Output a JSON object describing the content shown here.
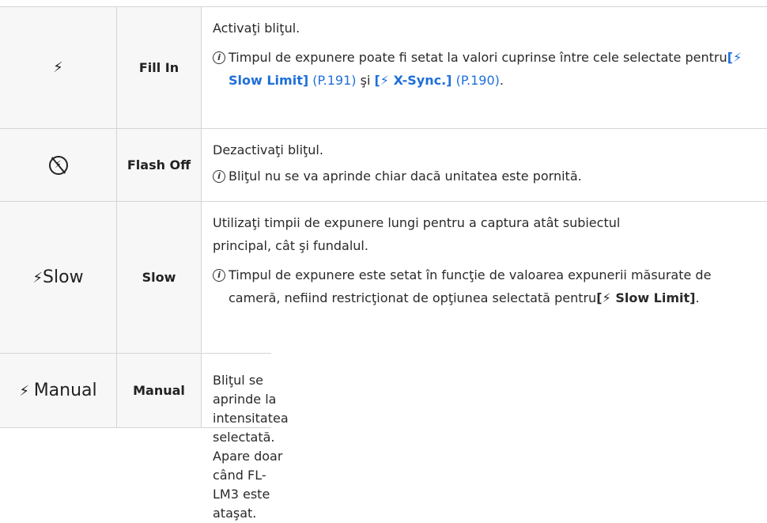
{
  "rows": [
    {
      "icon_label": "⚡",
      "icon_name": "flash-icon",
      "name": "Fill In",
      "desc_lines": [
        "Activaţi bliţul."
      ],
      "note": {
        "text_before": "Timpul de expunere poate fi setat la valori cuprinse între cele selectate pentru",
        "link1_text": "[⚡ Slow Limit]",
        "ref1": "(P.191)",
        "mid": "şi",
        "link2_text": "[⚡ X-Sync.]",
        "ref2": "(P.190)",
        "end": "."
      }
    },
    {
      "icon_label": "⚡",
      "icon_name": "flash-off-icon",
      "name": "Flash Off",
      "desc_lines": [
        "Dezactivaţi bliţul."
      ],
      "note": {
        "text": "Bliţul nu se va aprinde chiar dacă unitatea este pornită."
      }
    },
    {
      "icon_label": "Slow",
      "icon_name": "flash-slow-icon",
      "name": "Slow",
      "desc_lines": [
        "Utilizaţi timpii de expunere lungi pentru a captura atât subiectul",
        "principal, cât şi fundalul."
      ],
      "note": {
        "text_before": "Timpul de expunere este setat în funcţie de valoarea expunerii măsurate de cameră, nefiind restricţionat de opţiunea selectată pentru",
        "link_text": "[⚡ Slow Limit]",
        "end": "."
      }
    },
    {
      "icon_label": "Manual",
      "icon_name": "flash-manual-icon",
      "name": "Manual",
      "desc_lines": [
        "Bliţul se aprinde la intensitatea selectată.",
        "Apare doar când FL-LM3 este ataşat."
      ]
    }
  ],
  "note_symbol": "i",
  "colors": {
    "link": "#1f6fd9",
    "header_bg": "#f7f7f7",
    "border": "#d5d5d5"
  }
}
